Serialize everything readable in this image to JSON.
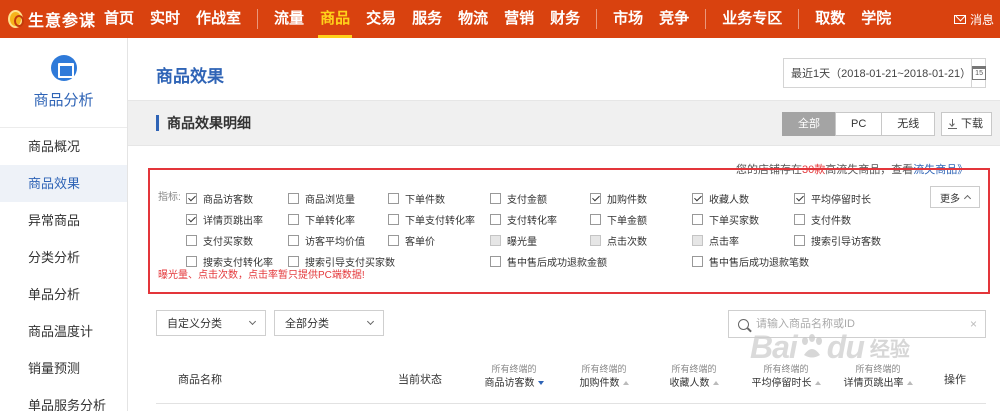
{
  "topnav": {
    "logo": "生意参谋",
    "items": [
      "首页",
      "实时",
      "作战室",
      "流量",
      "商品",
      "交易",
      "服务",
      "物流",
      "营销",
      "财务",
      "市场",
      "竞争",
      "业务专区",
      "取数",
      "学院"
    ],
    "active_index": 4,
    "message": "消息",
    "bg_color": "#d9420f",
    "active_color": "#ffd21a"
  },
  "sidebar": {
    "title": "商品分析",
    "icon": "clipboard-icon",
    "items": [
      "商品概况",
      "商品效果",
      "异常商品",
      "分类分析",
      "单品分析",
      "商品温度计",
      "销量预测",
      "单品服务分析"
    ],
    "active_index": 1
  },
  "main": {
    "page_title": "商品效果",
    "date_range": "最近1天（2018-01-21~2018-01-21）",
    "calendar_day": "15",
    "section_title": "商品效果明细",
    "segments": [
      "全部",
      "PC",
      "无线"
    ],
    "active_segment": 0,
    "download": "下载",
    "notice": {
      "prefix": "您的店铺存在",
      "count": "30款",
      "middle": "高流失商品，查看",
      "link": "流失商品》"
    }
  },
  "metrics": {
    "label": "指标:",
    "more": "更多",
    "note": "曝光量、点击次数，点击率暂只提供PC端数据!",
    "items": [
      {
        "label": "商品访客数",
        "checked": true,
        "disabled": false
      },
      {
        "label": "商品浏览量",
        "checked": false,
        "disabled": false
      },
      {
        "label": "下单件数",
        "checked": false,
        "disabled": false
      },
      {
        "label": "支付金额",
        "checked": false,
        "disabled": false
      },
      {
        "label": "加购件数",
        "checked": true,
        "disabled": false
      },
      {
        "label": "收藏人数",
        "checked": true,
        "disabled": false
      },
      {
        "label": "平均停留时长",
        "checked": true,
        "disabled": false
      },
      {
        "label": "详情页跳出率",
        "checked": true,
        "disabled": false
      },
      {
        "label": "下单转化率",
        "checked": false,
        "disabled": false
      },
      {
        "label": "下单支付转化率",
        "checked": false,
        "disabled": false
      },
      {
        "label": "支付转化率",
        "checked": false,
        "disabled": false
      },
      {
        "label": "下单金额",
        "checked": false,
        "disabled": false
      },
      {
        "label": "下单买家数",
        "checked": false,
        "disabled": false
      },
      {
        "label": "支付件数",
        "checked": false,
        "disabled": false
      },
      {
        "label": "支付买家数",
        "checked": false,
        "disabled": false
      },
      {
        "label": "访客平均价值",
        "checked": false,
        "disabled": false
      },
      {
        "label": "客单价",
        "checked": false,
        "disabled": false
      },
      {
        "label": "曝光量",
        "checked": false,
        "disabled": true
      },
      {
        "label": "点击次数",
        "checked": false,
        "disabled": true
      },
      {
        "label": "点击率",
        "checked": false,
        "disabled": true
      },
      {
        "label": "搜索引导访客数",
        "checked": false,
        "disabled": false
      },
      {
        "label": "搜索支付转化率",
        "checked": false,
        "disabled": false
      },
      {
        "label": "搜索引导支付买家数",
        "checked": false,
        "disabled": false
      },
      {
        "label": "售中售后成功退款金额",
        "checked": false,
        "disabled": false
      },
      {
        "label": "售中售后成功退款笔数",
        "checked": false,
        "disabled": false
      }
    ]
  },
  "filters": {
    "category_custom": "自定义分类",
    "category_all": "全部分类",
    "search_placeholder": "请输入商品名称或ID"
  },
  "table": {
    "col_name": "商品名称",
    "col_status": "当前状态",
    "col_action": "操作",
    "prefix": "所有终端的",
    "metric_cols": [
      "商品访客数",
      "加购件数",
      "收藏人数",
      "平均停留时长",
      "详情页跳出率"
    ]
  },
  "watermark": {
    "text": "Bai du",
    "cn": "经验"
  }
}
